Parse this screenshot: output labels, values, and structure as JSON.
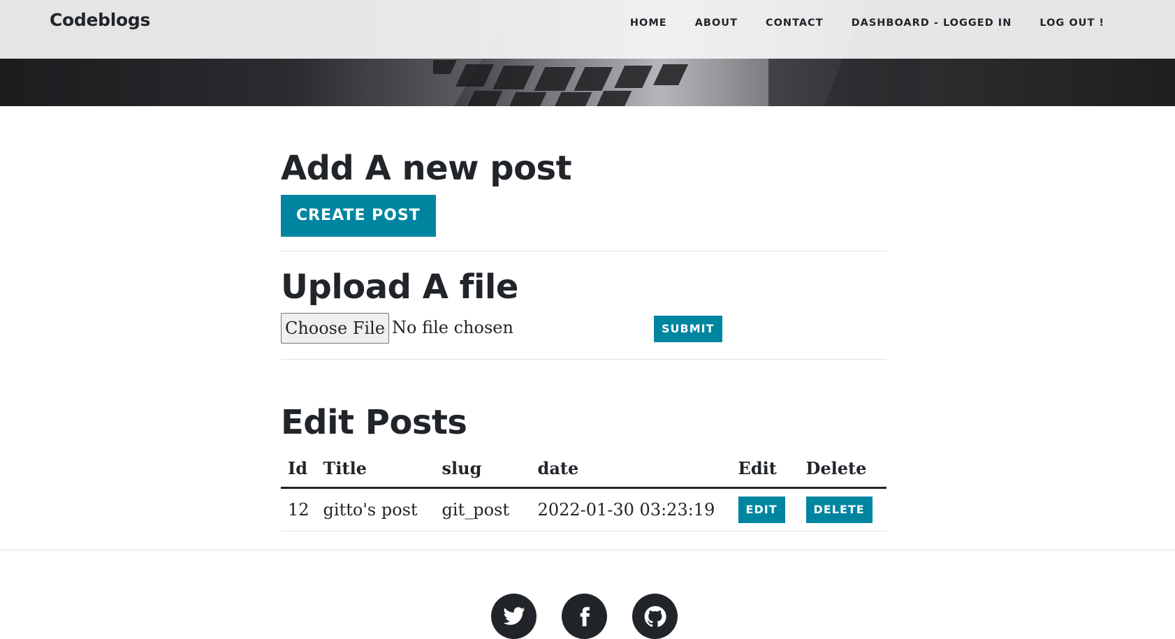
{
  "brand": "Codeblogs",
  "nav": [
    {
      "label": "Home"
    },
    {
      "label": "About"
    },
    {
      "label": "Contact"
    },
    {
      "label": "Dashboard - Logged In"
    },
    {
      "label": "Log Out !"
    }
  ],
  "add_post": {
    "heading": "Add A new post",
    "button_label": "Create Post"
  },
  "upload": {
    "heading": "Upload A file",
    "choose_label": "Choose File",
    "file_status": "No file chosen",
    "submit_label": "Submit"
  },
  "edit_posts": {
    "heading": "Edit Posts",
    "columns": [
      "Id",
      "Title",
      "slug",
      "date",
      "Edit",
      "Delete"
    ],
    "rows": [
      {
        "id": "12",
        "title": "gitto's post",
        "slug": "git_post",
        "date": "2022-01-30 03:23:19",
        "edit_label": "Edit",
        "delete_label": "Delete"
      }
    ]
  },
  "social": [
    "twitter-icon",
    "facebook-icon",
    "github-icon"
  ],
  "colors": {
    "accent": "#0085a1",
    "text": "#212529",
    "navbar_bg": "#f4f4f5"
  }
}
